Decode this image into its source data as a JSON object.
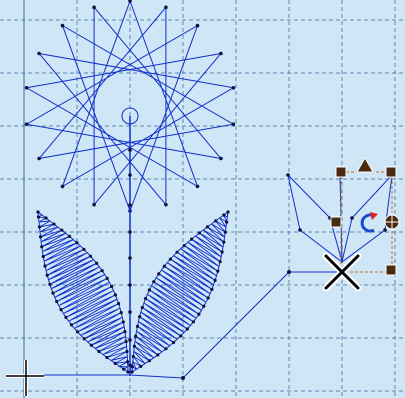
{
  "app": {
    "view": "embroidery-design-canvas"
  },
  "colors": {
    "canvas_bg": "#cfe6f7",
    "grid_line": "#5c86b0",
    "stitch_line": "#1030c8",
    "stitch_point": "#101040",
    "handle_fill": "#4a2a10",
    "handle_outline": "#ffffff",
    "rotate_icon_blue": "#1a4ad0",
    "rotate_icon_red": "#e02020",
    "origin_cross": "#000000"
  },
  "objects": [
    {
      "id": "star-flower-head",
      "kind": "running-stitch-star"
    },
    {
      "id": "flower-stem",
      "kind": "running-stitch-line"
    },
    {
      "id": "left-leaf",
      "kind": "satin-fill"
    },
    {
      "id": "right-leaf",
      "kind": "satin-fill"
    },
    {
      "id": "small-leaf-outline",
      "kind": "running-stitch-outline",
      "selected": true
    }
  ],
  "selection": {
    "handles": [
      "top-left-handle",
      "top-right-handle",
      "bottom-right-handle",
      "left-handle",
      "right-handle"
    ],
    "tools": [
      "move-up-arrow-icon",
      "rotate-icon",
      "move-cross-icon"
    ]
  },
  "icons": [
    "origin-cross-icon",
    "rotate-icon",
    "move-cross-icon",
    "move-up-arrow-icon"
  ]
}
